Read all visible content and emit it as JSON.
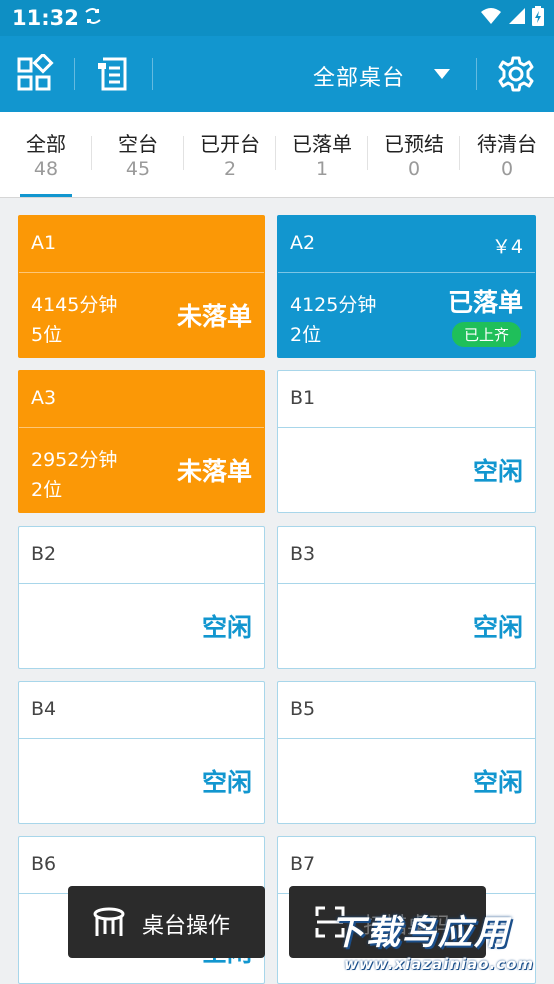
{
  "status_bar": {
    "time": "11:32"
  },
  "app_bar": {
    "title": "全部桌台"
  },
  "tabs": [
    {
      "label": "全部",
      "count": "48"
    },
    {
      "label": "空台",
      "count": "45"
    },
    {
      "label": "已开台",
      "count": "2"
    },
    {
      "label": "已落单",
      "count": "1"
    },
    {
      "label": "已预结",
      "count": "0"
    },
    {
      "label": "待清台",
      "count": "0"
    }
  ],
  "tables": [
    {
      "name": "A1",
      "minutes": "4145分钟",
      "guests": "5位",
      "status": "未落单"
    },
    {
      "name": "A2",
      "price": "￥4",
      "minutes": "4125分钟",
      "guests": "2位",
      "status": "已落单",
      "badge": "已上齐"
    },
    {
      "name": "A3",
      "minutes": "2952分钟",
      "guests": "2位",
      "status": "未落单"
    },
    {
      "name": "B1",
      "status": "空闲"
    },
    {
      "name": "B2",
      "status": "空闲"
    },
    {
      "name": "B3",
      "status": "空闲"
    },
    {
      "name": "B4",
      "status": "空闲"
    },
    {
      "name": "B5",
      "status": "空闲"
    },
    {
      "name": "B6",
      "status": "空闲"
    },
    {
      "name": "B7"
    }
  ],
  "bottom_actions": {
    "table_ops": "桌台操作",
    "scan": "扫描桌码"
  },
  "watermark": {
    "brand": "下载鸟应用",
    "url": "www.xiazainiao.com"
  },
  "colors": {
    "primary": "#1296cf",
    "orange": "#fb9806",
    "green_badge": "#1fbf5a"
  }
}
